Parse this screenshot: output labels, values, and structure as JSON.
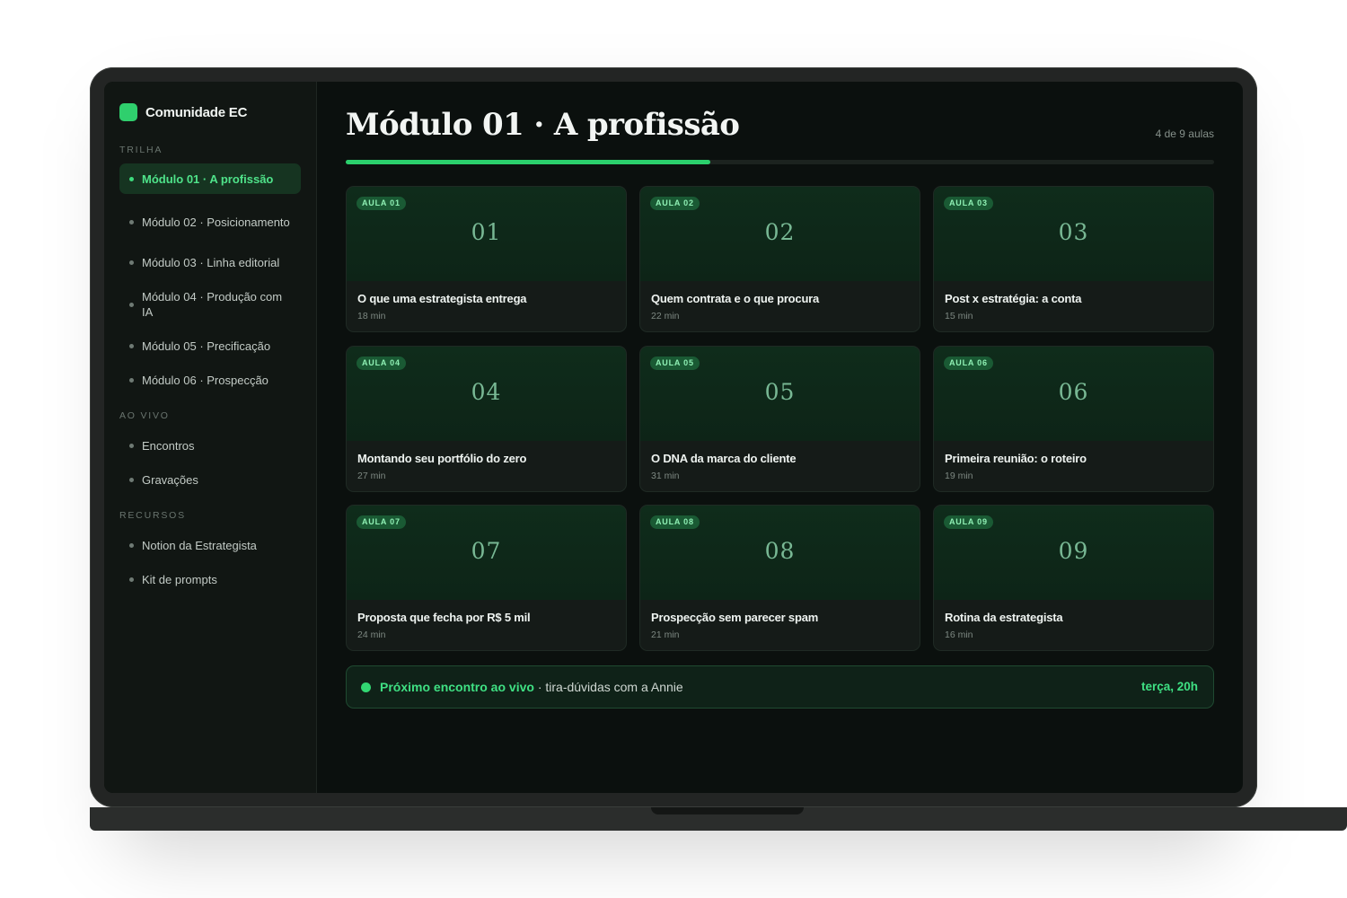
{
  "brand": {
    "name": "Comunidade EC",
    "accent": "#2fcf6d"
  },
  "sidebar": {
    "sections": [
      {
        "label": "TRILHA",
        "items": [
          {
            "label": "Módulo 01 · A profissão",
            "active": true
          },
          {
            "label": "Módulo 02 · Posicionamento"
          },
          {
            "label": "Módulo 03 · Linha editorial"
          },
          {
            "label": "Módulo 04 · Produção com IA"
          },
          {
            "label": "Módulo 05 · Precificação"
          },
          {
            "label": "Módulo 06 · Prospecção"
          }
        ]
      },
      {
        "label": "AO VIVO",
        "items": [
          {
            "label": "Encontros"
          },
          {
            "label": "Gravações"
          }
        ]
      },
      {
        "label": "RECURSOS",
        "items": [
          {
            "label": "Notion da Estrategista"
          },
          {
            "label": "Kit de prompts"
          }
        ]
      }
    ]
  },
  "header": {
    "title": "Módulo 01 · A profissão",
    "lesson_count": "4 de 9 aulas",
    "progress": 0.42
  },
  "lessons": [
    {
      "badge": "AULA 01",
      "number": "01",
      "title": "O que uma estrategista entrega",
      "duration": "18 min"
    },
    {
      "badge": "AULA 02",
      "number": "02",
      "title": "Quem contrata e o que procura",
      "duration": "22 min"
    },
    {
      "badge": "AULA 03",
      "number": "03",
      "title": "Post x estratégia: a conta",
      "duration": "15 min"
    },
    {
      "badge": "AULA 04",
      "number": "04",
      "title": "Montando seu portfólio do zero",
      "duration": "27 min"
    },
    {
      "badge": "AULA 05",
      "number": "05",
      "title": "O DNA da marca do cliente",
      "duration": "31 min"
    },
    {
      "badge": "AULA 06",
      "number": "06",
      "title": "Primeira reunião: o roteiro",
      "duration": "19 min"
    },
    {
      "badge": "AULA 07",
      "number": "07",
      "title": "Proposta que fecha por R$ 5 mil",
      "duration": "24 min"
    },
    {
      "badge": "AULA 08",
      "number": "08",
      "title": "Prospecção sem parecer spam",
      "duration": "21 min"
    },
    {
      "badge": "AULA 09",
      "number": "09",
      "title": "Rotina da estrategista",
      "duration": "16 min"
    }
  ],
  "live": {
    "label": "Próximo encontro ao vivo",
    "description": " · tira-dúvidas com a Annie",
    "time": "terça, 20h"
  }
}
